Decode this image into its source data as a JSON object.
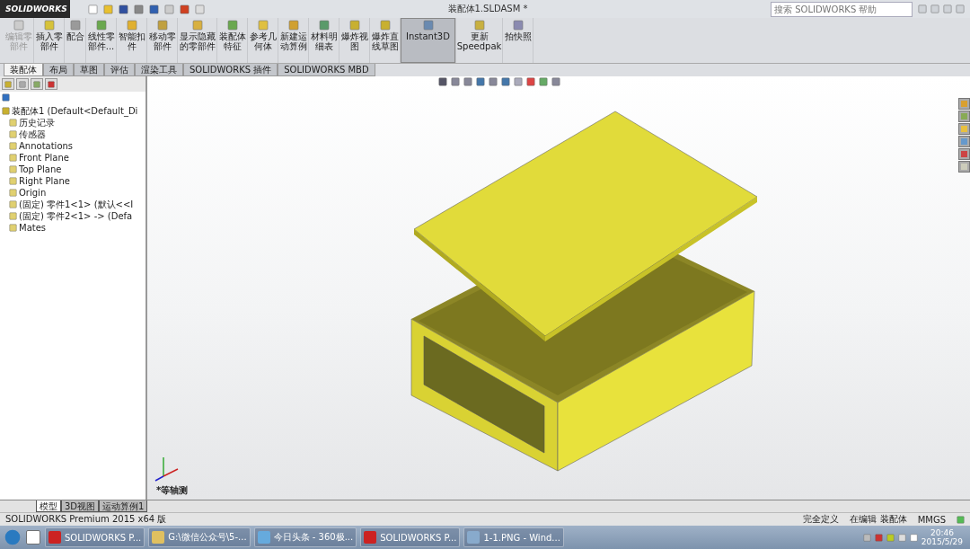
{
  "window": {
    "app_name": "SOLIDWORKS",
    "title": "装配体1.SLDASM *",
    "search": {
      "placeholder": "搜索 SOLIDWORKS 帮助"
    }
  },
  "toolbar": [
    {
      "label": "编辑零部件",
      "disabled": true,
      "selected": false
    },
    {
      "label": "插入零部件",
      "disabled": false,
      "selected": false
    },
    {
      "label": "配合",
      "disabled": false,
      "selected": false
    },
    {
      "label": "线性零部件...",
      "disabled": false,
      "selected": false
    },
    {
      "label": "智能扣件",
      "disabled": false,
      "selected": false
    },
    {
      "label": "移动零部件",
      "disabled": false,
      "selected": false
    },
    {
      "label": "显示隐藏的零部件",
      "disabled": false,
      "selected": false
    },
    {
      "label": "装配体特征",
      "disabled": false,
      "selected": false
    },
    {
      "label": "参考几何体",
      "disabled": false,
      "selected": false
    },
    {
      "label": "新建运动算例",
      "disabled": false,
      "selected": false
    },
    {
      "label": "材料明细表",
      "disabled": false,
      "selected": false
    },
    {
      "label": "爆炸视图",
      "disabled": false,
      "selected": false
    },
    {
      "label": "爆炸直线草图",
      "disabled": false,
      "selected": false
    },
    {
      "label": "Instant3D",
      "disabled": false,
      "selected": true
    },
    {
      "label": "更新 Speedpak",
      "disabled": false,
      "selected": false
    },
    {
      "label": "拍快照",
      "disabled": false,
      "selected": false
    }
  ],
  "tabs": [
    {
      "label": "装配体",
      "selected": true
    },
    {
      "label": "布局",
      "selected": false
    },
    {
      "label": "草图",
      "selected": false
    },
    {
      "label": "评估",
      "selected": false
    },
    {
      "label": "渲染工具",
      "selected": false
    },
    {
      "label": "SOLIDWORKS 插件",
      "selected": false
    },
    {
      "label": "SOLIDWORKS MBD",
      "selected": false
    }
  ],
  "tree": {
    "label": "装配体1 (Default<Default_Di",
    "children": [
      {
        "label": "历史记录"
      },
      {
        "label": "传感器"
      },
      {
        "label": "Annotations"
      },
      {
        "label": "Front Plane"
      },
      {
        "label": "Top Plane"
      },
      {
        "label": "Right Plane"
      },
      {
        "label": "Origin"
      },
      {
        "label": "(固定) 零件1<1> (默认<<I"
      },
      {
        "label": "(固定) 零件2<1> -> (Defa"
      },
      {
        "label": "Mates"
      }
    ]
  },
  "viewport": {
    "view_label": "*等轴测"
  },
  "bottom_tabs": [
    {
      "label": "模型",
      "selected": true
    },
    {
      "label": "3D视图",
      "selected": false
    },
    {
      "label": "运动算例1",
      "selected": false
    }
  ],
  "status_bar": {
    "product": "SOLIDWORKS Premium 2015 x64 版",
    "state": "完全定义",
    "editing": "在编辑 装配体",
    "units": "MMGS"
  },
  "taskbar": {
    "items": [
      {
        "label": "SOLIDWORKS P..."
      },
      {
        "label": "G:\\微信公众号\\5-..."
      },
      {
        "label": "今日头条 - 360极..."
      },
      {
        "label": "SOLIDWORKS P..."
      },
      {
        "label": "1-1.PNG - Wind..."
      }
    ],
    "time": "20:46",
    "date": "2015/5/29"
  }
}
